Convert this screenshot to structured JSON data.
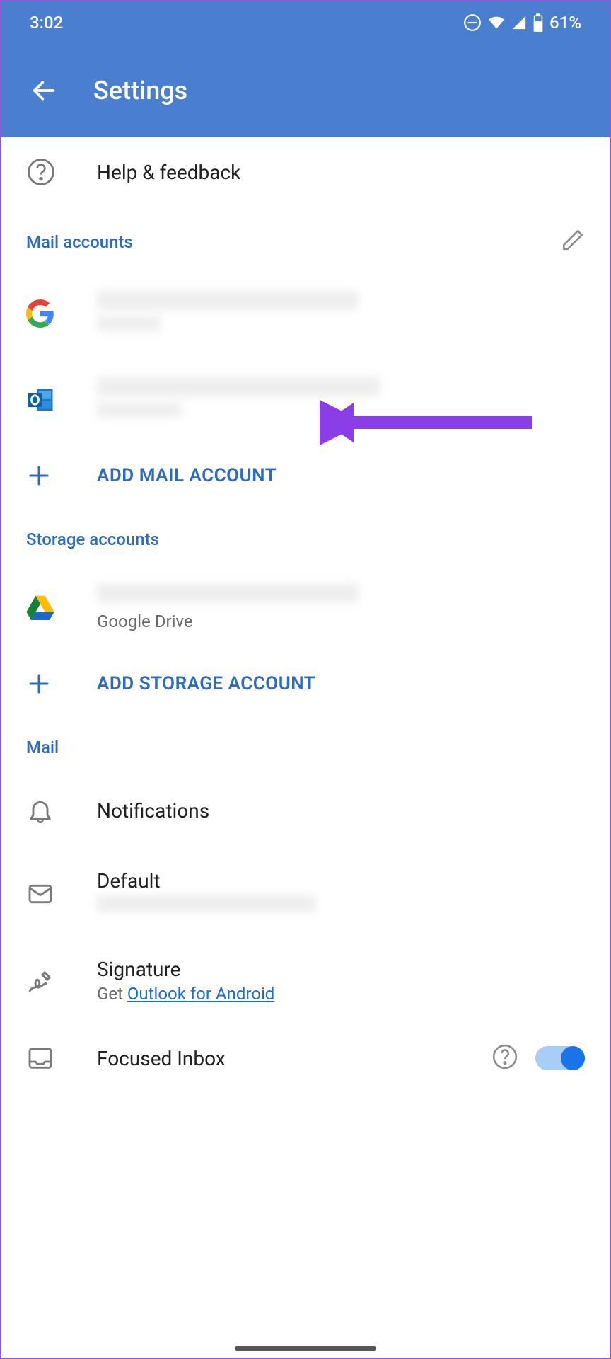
{
  "status_bar": {
    "time": "3:02",
    "battery_pct": "61%"
  },
  "header": {
    "title": "Settings"
  },
  "help_row": {
    "label": "Help & feedback"
  },
  "sections": {
    "mail_accounts": {
      "title": "Mail accounts",
      "add_label": "ADD MAIL ACCOUNT"
    },
    "storage_accounts": {
      "title": "Storage accounts",
      "drive_sub": "Google Drive",
      "add_label": "ADD STORAGE ACCOUNT"
    },
    "mail": {
      "title": "Mail",
      "notifications": "Notifications",
      "default_title": "Default",
      "signature_title": "Signature",
      "signature_sub_prefix": "Get ",
      "signature_link": "Outlook for Android",
      "focused_inbox": "Focused Inbox"
    }
  }
}
